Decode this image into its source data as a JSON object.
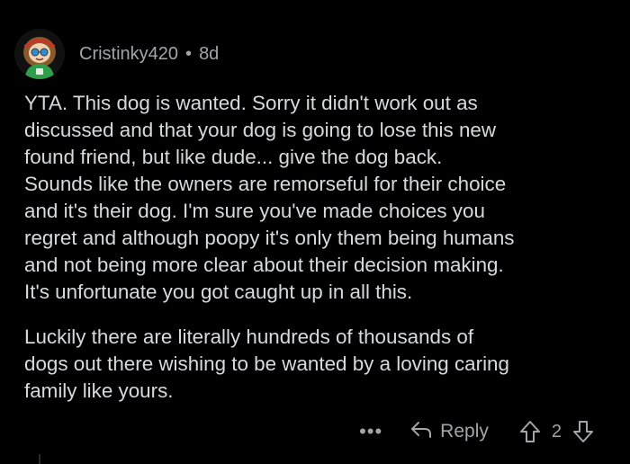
{
  "comment": {
    "username": "Cristinky420",
    "separator": "•",
    "age": "8d",
    "paragraphs": [
      [
        "YTA.  This dog is wanted.  Sorry it didn't work out as",
        "discussed and that your dog is going to lose this new",
        "found friend, but like dude... give the dog back.",
        "Sounds like the owners are remorseful for their choice",
        "and it's their dog.  I'm sure you've made choices you",
        "regret and although poopy it's only them being humans",
        "and not being more clear about their decision making.",
        "It's unfortunate you got caught up in all this."
      ],
      [
        "Luckily there are literally hundreds of thousands of",
        "dogs out there wishing to be wanted by a loving caring",
        "family like yours."
      ]
    ]
  },
  "actions": {
    "more_label": "•••",
    "reply_label": "Reply",
    "score": "2"
  },
  "icons": {
    "avatar": "user-avatar",
    "reply": "reply-arrow-icon",
    "upvote": "upvote-arrow-icon",
    "downvote": "downvote-arrow-icon"
  },
  "colors": {
    "background": "#000000",
    "text": "#d7dadc",
    "meta": "#a3a6a8"
  }
}
